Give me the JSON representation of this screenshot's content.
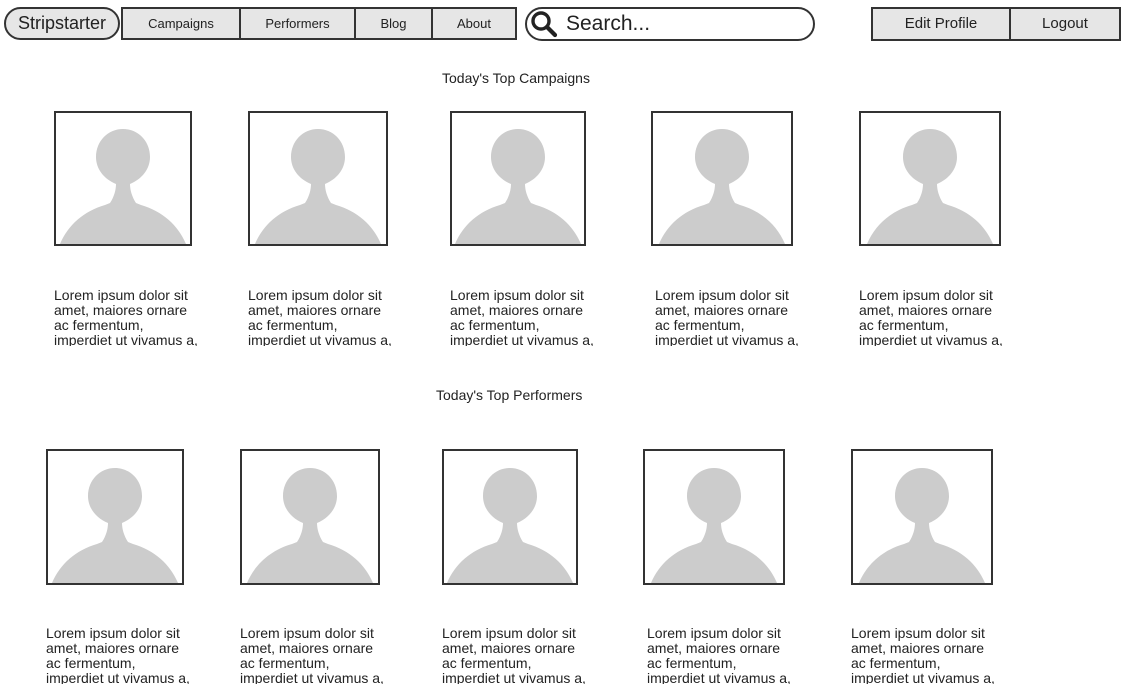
{
  "header": {
    "logo": "Stripstarter",
    "nav": [
      "Campaigns",
      "Performers",
      "Blog",
      "About"
    ],
    "search_placeholder": "Search...",
    "account": [
      "Edit Profile",
      "Logout"
    ]
  },
  "campaigns": {
    "title": "Today's Top Campaigns",
    "items": [
      "Lorem ipsum dolor sit amet, maiores ornare ac fermentum, imperdiet ut vivamus a, nam lectus at nunc.",
      "Lorem ipsum dolor sit amet, maiores ornare ac fermentum, imperdiet ut vivamus a, nam lectus at nunc.",
      "Lorem ipsum dolor sit amet, maiores ornare ac fermentum, imperdiet ut vivamus a, nam lectus at nunc.",
      "Lorem ipsum dolor sit amet, maiores ornare ac fermentum, imperdiet ut vivamus a, nam lectus at nunc.",
      "Lorem ipsum dolor sit amet, maiores ornare ac fermentum, imperdiet ut vivamus a, nam lectus at nunc."
    ]
  },
  "performers": {
    "title": "Today's Top Performers",
    "items": [
      "Lorem ipsum dolor sit amet, maiores ornare ac fermentum, imperdiet ut vivamus a, nam lectus at nunc.",
      "Lorem ipsum dolor sit amet, maiores ornare ac fermentum, imperdiet ut vivamus a, nam lectus at nunc.",
      "Lorem ipsum dolor sit amet, maiores ornare ac fermentum, imperdiet ut vivamus a, nam lectus at nunc.",
      "Lorem ipsum dolor sit amet, maiores ornare ac fermentum, imperdiet ut vivamus a, nam lectus at nunc.",
      "Lorem ipsum dolor sit amet, maiores ornare ac fermentum, imperdiet ut vivamus a, nam lectus at nunc."
    ]
  },
  "icons": {
    "search": "search-icon",
    "placeholder_image": "user-placeholder-icon"
  },
  "colors": {
    "border": "#333333",
    "button_bg": "#e6e6e6",
    "placeholder_fill": "#cccccc"
  }
}
